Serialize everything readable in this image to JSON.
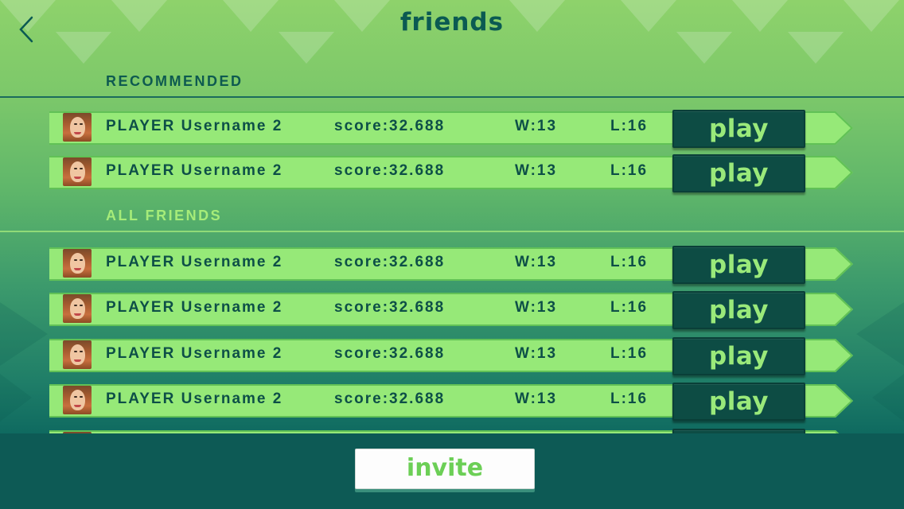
{
  "header": {
    "title": "friends",
    "back_icon": "chevron-left-icon"
  },
  "sections": {
    "recommended_label": "RECOMMENDED",
    "all_friends_label": "ALL FRIENDS"
  },
  "recommended": [
    {
      "name": "PLAYER Username 2",
      "score": "score:32.688",
      "wins": "W:13",
      "losses": "L:16",
      "action": "play"
    },
    {
      "name": "PLAYER Username 2",
      "score": "score:32.688",
      "wins": "W:13",
      "losses": "L:16",
      "action": "play"
    }
  ],
  "all_friends": [
    {
      "name": "PLAYER Username 2",
      "score": "score:32.688",
      "wins": "W:13",
      "losses": "L:16",
      "action": "play"
    },
    {
      "name": "PLAYER Username 2",
      "score": "score:32.688",
      "wins": "W:13",
      "losses": "L:16",
      "action": "play"
    },
    {
      "name": "PLAYER Username 2",
      "score": "score:32.688",
      "wins": "W:13",
      "losses": "L:16",
      "action": "play"
    },
    {
      "name": "PLAYER Username 2",
      "score": "score:32.688",
      "wins": "W:13",
      "losses": "L:16",
      "action": "play"
    },
    {
      "name": "",
      "score": "",
      "wins": "",
      "losses": "",
      "action": ""
    }
  ],
  "footer": {
    "invite_label": "invite"
  },
  "colors": {
    "row_fill": "#96e978",
    "play_button": "#0d4c44",
    "text_dark": "#0d4f47",
    "accent_green": "#9ae97a"
  }
}
